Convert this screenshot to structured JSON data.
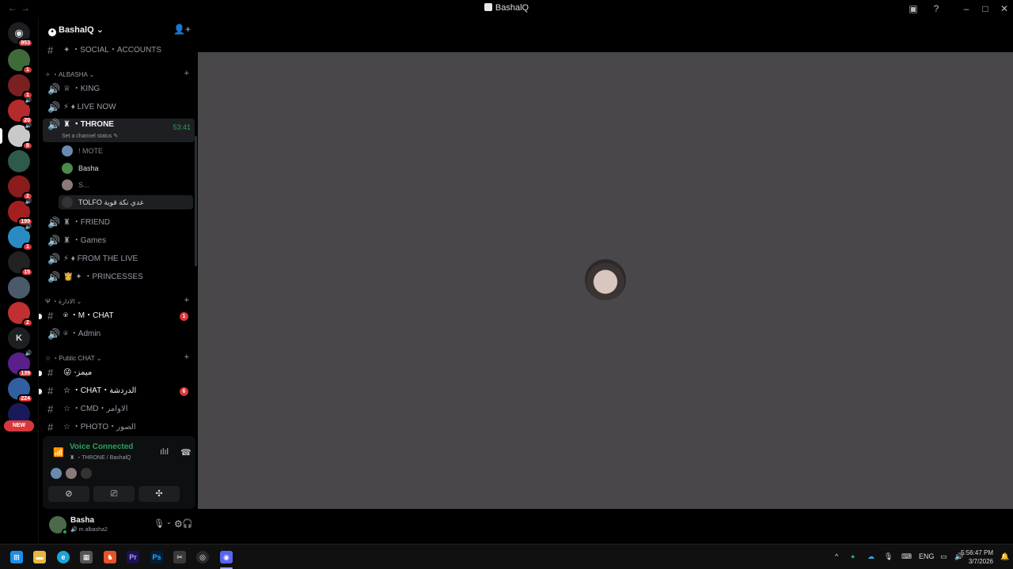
{
  "window": {
    "title": "BashalQ"
  },
  "rail": {
    "home_badge": "953",
    "guilds": [
      {
        "name": "server-1",
        "badge": "1",
        "speaker": false,
        "color": "#3f6b3a"
      },
      {
        "name": "server-2",
        "badge": "1",
        "speaker": false,
        "color": "#7a2020"
      },
      {
        "name": "server-3",
        "badge": "20",
        "speaker": true,
        "color": "#b52a2a"
      },
      {
        "name": "server-4",
        "badge": "8",
        "speaker": true,
        "color": "#c9c9c9"
      },
      {
        "name": "server-5",
        "badge": "",
        "speaker": false,
        "color": "#2d5a4a"
      },
      {
        "name": "server-6",
        "badge": "2",
        "speaker": false,
        "color": "#8a1c1c"
      },
      {
        "name": "server-7",
        "badge": "199",
        "speaker": true,
        "color": "#a31f1f"
      },
      {
        "name": "server-8",
        "badge": "1",
        "speaker": true,
        "color": "#2a8bc2"
      },
      {
        "name": "server-9",
        "badge": "15",
        "speaker": false,
        "color": "#222"
      },
      {
        "name": "server-10",
        "badge": "",
        "speaker": false,
        "color": "#4a5a6a"
      },
      {
        "name": "server-11",
        "badge": "2",
        "speaker": false,
        "color": "#c03030"
      },
      {
        "name": "server-k",
        "badge": "",
        "speaker": false,
        "color": "#1e1f22",
        "letter": "K"
      },
      {
        "name": "server-12",
        "badge": "139",
        "speaker": true,
        "color": "#5a1f8a"
      },
      {
        "name": "server-13",
        "badge": "224",
        "speaker": false,
        "color": "#3060a0"
      },
      {
        "name": "server-14",
        "badge": "",
        "speaker": false,
        "color": "#1a1a5a"
      }
    ],
    "new_label": "NEW"
  },
  "sidebar": {
    "server_name": "BashalQ",
    "top_channel": "✦ ・SOCIAL・ACCOUNTS",
    "category_albasha": "ALBASHA",
    "channels_albasha": [
      {
        "label": "♕ ・KING"
      },
      {
        "label": "⚡ ♦ LIVE NOW"
      }
    ],
    "active_channel": {
      "label": "♜ ・THRONE",
      "timer": "53:41",
      "status": "Set a channel status ✎"
    },
    "voice_users": [
      {
        "name": "! MOTE",
        "dim": true,
        "color": "#6a8ab0"
      },
      {
        "name": "Basha",
        "dim": false,
        "color": "#4a8a4a"
      },
      {
        "name": "S...",
        "dim": true,
        "color": "#8a7a7a"
      },
      {
        "name": "TOLFO عدي نكة قوية",
        "dim": false,
        "color": "#333"
      }
    ],
    "channels_after": [
      {
        "label": "♜ ・FRIEND"
      },
      {
        "label": "♜ ・Games"
      },
      {
        "label": "⚡ ♦ FROM THE LIVE"
      },
      {
        "label": "👸 ✦ ・PRINCESSES"
      }
    ],
    "category_admin": "الادارة",
    "admin_channels": [
      {
        "label": "⍟ ・M・CHAT",
        "badge": "1"
      },
      {
        "label": "⍟ ・Admin",
        "badge": ""
      }
    ],
    "category_public": "Public CHAT",
    "public_channels": [
      {
        "label": "😜 -ميمز",
        "badge": ""
      },
      {
        "label": "☆ ・CHAT・الدردشة",
        "badge": "6"
      },
      {
        "label": "☆ ・CMD・الاوامر",
        "badge": ""
      },
      {
        "label": "☆ ・PHOTO・الصور",
        "badge": ""
      }
    ]
  },
  "voice_panel": {
    "title": "Voice Connected",
    "subtitle": "♜ ・THRONE / BashalQ"
  },
  "user": {
    "name": "Basha",
    "status": "m.albasha2"
  },
  "taskbar": {
    "lang": "ENG",
    "time": "5:56:47 PM",
    "date": "3/7/2026"
  }
}
